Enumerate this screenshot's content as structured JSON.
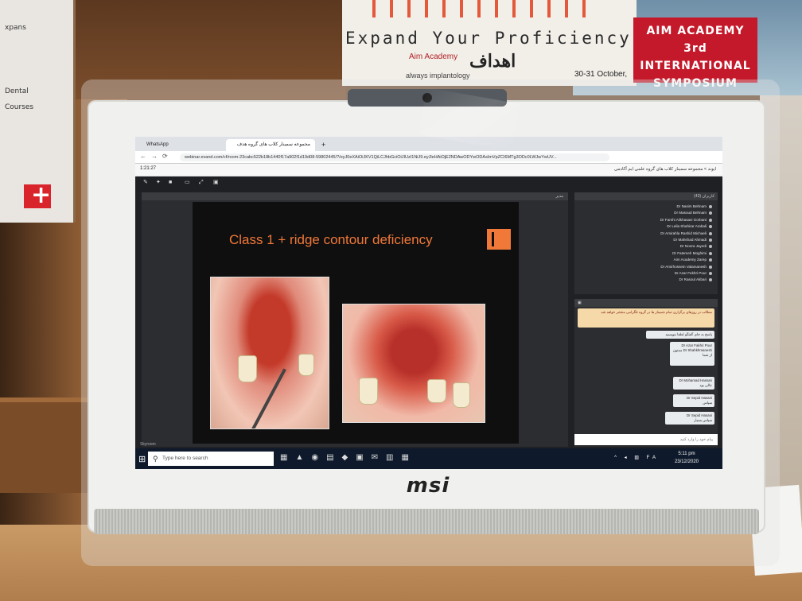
{
  "background": {
    "left_poster_lines": [
      "xpans",
      "Dental",
      "Courses"
    ],
    "banner": {
      "headline": "Expand Your Proficiency",
      "brand": "Aim Academy",
      "tagline": "always implantology",
      "logo_text": "اهداف",
      "date": "30-31 October,"
    },
    "aim_sign": [
      "AIM ACADEMY",
      "3rd INTERNATIONAL",
      "SYMPOSIUM"
    ],
    "colors": {
      "aim_red": "#c4192a",
      "slide_orange": "#f07838"
    }
  },
  "monitor": {
    "brand": "msi"
  },
  "browser": {
    "tabs": [
      {
        "label": "WhatsApp",
        "icon": "whatsapp-icon"
      },
      {
        "label": "مجموعه سمینار کلاب های گروه هدف",
        "icon": "evand-icon"
      }
    ],
    "url": "webinar.evand.com/cf/room-23cabc522b18b1440f17a902f1d19d08-59802445/?/eyJ0eXAiOiJKV1QiLCJhbGciOiJIUzI1NiJ9.eyJleHAiOjE2NDAwODYwODAsImVpZCI6MTg3ODc0LWJwYwUV..."
  },
  "webinar": {
    "timer": "1:21:27",
    "title": "ایوند > مجموعه سمینار کلاب های گروه علمی ایم آکادمی",
    "stage_label": "مدیر",
    "slide": {
      "title": "Class 1 + ridge contour deficiency"
    },
    "participants": {
      "header": "کاربران (43)",
      "list": [
        "Dr Nasim Behnam",
        "Dr Masoud Behnam",
        "Dr Farshi Alikhasavi Gorbani",
        "Dr Leila Shahirar Arabali",
        "Dr Amirahla Rashid Michaeli",
        "Dr Mahshad Ahmadi",
        "Dr Noora Jayedi",
        "Dr Fatemeh Moghimi",
        "Aim Academy Zarep",
        "Dr Amirhossein Valamanesh",
        "Dr Azar Fekhri Pour",
        "Dr Rasoul Akbari"
      ]
    },
    "chat": {
      "messages": [
        {
          "author": "برگزار کننده",
          "text": "مطالب در روزهای برگزاری تمام شمینار ها در گروه تلگرامی منتشر خواهد شد",
          "type": "sys"
        },
        {
          "author": "",
          "text": "پاسخ به جای گفتگو لطفا بنویسید",
          "type": "user"
        },
        {
          "author": "Dr Azar Fakhri Pour",
          "text": "Dr Shahkhmanesh ممنون از شما",
          "type": "user"
        },
        {
          "author": "Dr Mohamad Hassan",
          "text": "عالی بود",
          "type": "user"
        },
        {
          "author": "Dr Sepid Hasani",
          "text": "سپاس",
          "type": "user"
        },
        {
          "author": "Dr Sepid Hasani",
          "text": "سپاس بسیار",
          "type": "user"
        }
      ],
      "input_placeholder": "پیام خود را وارد کنید"
    },
    "footer_label": "Skyroom"
  },
  "taskbar": {
    "search_placeholder": "Type here to search",
    "time": "5:11 pm",
    "date": "23/12/2020",
    "lang": "FA"
  }
}
